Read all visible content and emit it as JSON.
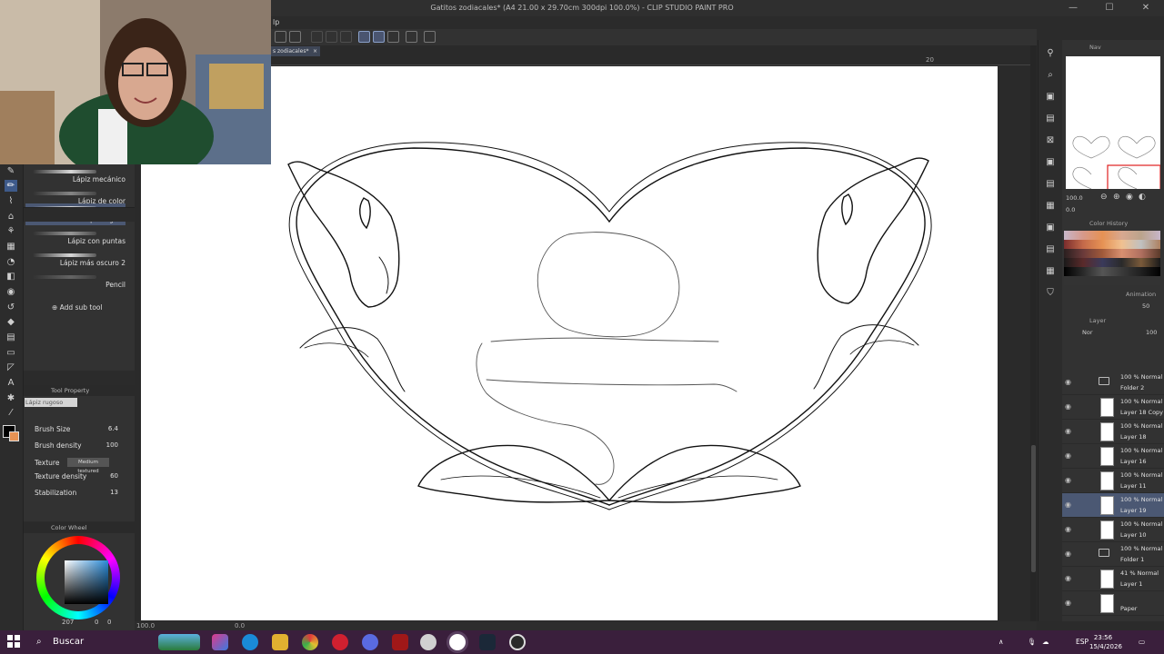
{
  "window": {
    "title": "Gatitos zodiacales* (A4 21.00 x 29.70cm 300dpi 100.0%) - CLIP STUDIO PAINT PRO",
    "menu_fragment": "lp"
  },
  "document": {
    "tab_label": "s zodiacales*",
    "ruler_label": "20"
  },
  "subtool_panel": {
    "brushes": [
      {
        "label": "Lápiz mecánico",
        "selected": false
      },
      {
        "label": "Lápiz de color",
        "selected": false
      },
      {
        "label": "Lápiz rugoso",
        "selected": true
      },
      {
        "label": "Lápiz con puntas",
        "selected": false
      },
      {
        "label": "Lápiz más oscuro 2",
        "selected": false
      },
      {
        "label": "Pencil",
        "selected": false
      }
    ],
    "add_sub_tool": "Add sub tool"
  },
  "tool_property": {
    "panel_title": "Tool Property",
    "current_tool": "Lápiz rugoso",
    "brush_size_label": "Brush Size",
    "brush_size_value": "6.4",
    "brush_density_label": "Brush density",
    "brush_density_value": "100",
    "texture_label": "Texture",
    "texture_value": "Medium textured",
    "texture_density_label": "Texture density",
    "texture_density_value": "60",
    "stabilization_label": "Stabilization",
    "stabilization_value": "13"
  },
  "color_wheel": {
    "panel_title": "Color Wheel",
    "readout_value": "207",
    "readout_values": [
      "0",
      "0"
    ],
    "main_color": "#000000",
    "sub_color": "#e69254"
  },
  "navigator": {
    "label": "Nav",
    "zoom": "100.0",
    "rotation": "0.0"
  },
  "color_history": {
    "panel_title": "Color History"
  },
  "animation": {
    "panel_title": "Animation",
    "opacity": "50"
  },
  "layer_panel": {
    "title": "Layer",
    "blend_mode": "Nor",
    "opacity": "100",
    "layers": [
      {
        "mode": "100 % Normal",
        "name": "Folder 2",
        "kind": "folder",
        "selected": false
      },
      {
        "mode": "100 % Normal",
        "name": "Layer 18 Copy",
        "kind": "layer",
        "selected": false
      },
      {
        "mode": "100 % Normal",
        "name": "Layer 18",
        "kind": "layer",
        "selected": false
      },
      {
        "mode": "100 % Normal",
        "name": "Layer 16",
        "kind": "layer",
        "selected": false
      },
      {
        "mode": "100 % Normal",
        "name": "Layer 11",
        "kind": "layer",
        "selected": false
      },
      {
        "mode": "100 % Normal",
        "name": "Layer 19",
        "kind": "layer",
        "selected": true
      },
      {
        "mode": "100 % Normal",
        "name": "Layer 10",
        "kind": "layer",
        "selected": false
      },
      {
        "mode": "100 % Normal",
        "name": "Folder 1",
        "kind": "folder",
        "selected": false
      },
      {
        "mode": "41 % Normal",
        "name": "Layer 1",
        "kind": "layer",
        "selected": false
      },
      {
        "mode": "",
        "name": "Paper",
        "kind": "paper",
        "selected": false
      }
    ]
  },
  "statusbar": {
    "zoom": "100.0",
    "angle": "0.0"
  },
  "taskbar": {
    "search_label": "Buscar",
    "language": "ESP",
    "time": "23:56",
    "date": "15/4/2026",
    "accent": "#3a1f3c"
  }
}
